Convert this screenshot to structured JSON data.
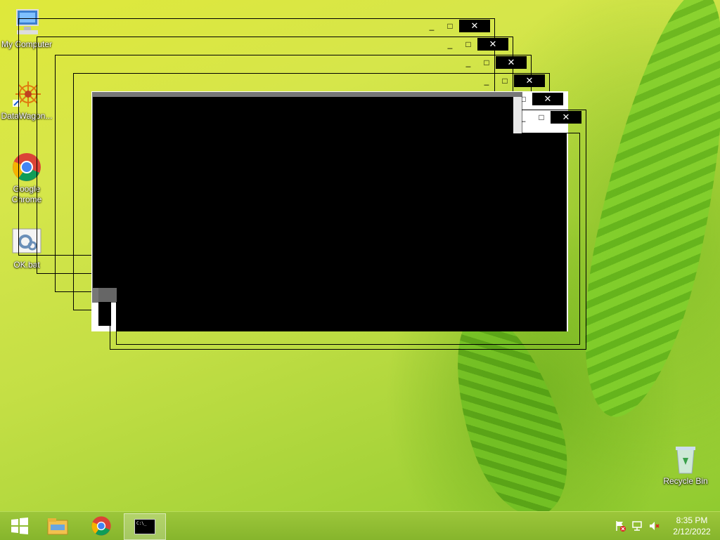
{
  "desktop": {
    "icons": [
      {
        "label": "My Computer",
        "icon": "computer-icon"
      },
      {
        "label": "DataWagon...",
        "icon": "datawagon-icon"
      },
      {
        "label": "Google Chrome",
        "icon": "chrome-icon"
      },
      {
        "label": "OK.bat",
        "icon": "batch-file-icon"
      },
      {
        "label": "Recycle Bin",
        "icon": "recycle-bin-icon"
      }
    ]
  },
  "window_controls": {
    "minimize": "_",
    "maximize": "□",
    "close": "✕"
  },
  "scroll_arrow": "⌄",
  "taskbar": {
    "start": "start-icon",
    "pinned": [
      "file-explorer-icon",
      "chrome-icon",
      "command-prompt-icon"
    ],
    "cmd_label": "C:\\_",
    "clock_time": "8:35 PM",
    "clock_date": "2/12/2022",
    "tray_icons": [
      "action-center-flag-icon",
      "network-icon",
      "volume-muted-icon"
    ]
  }
}
